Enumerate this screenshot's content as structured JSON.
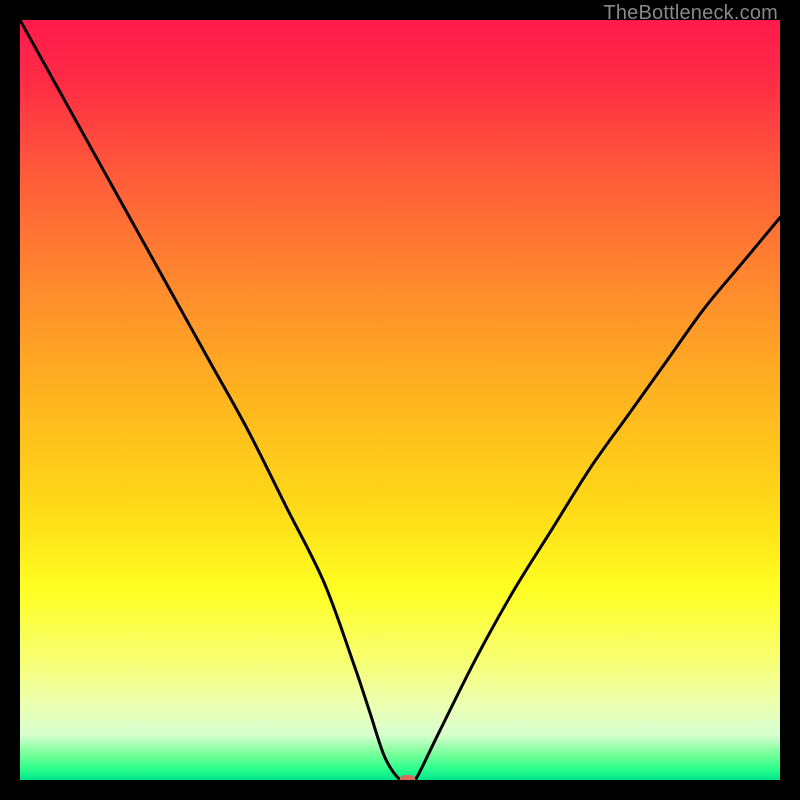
{
  "watermark": "TheBottleneck.com",
  "chart_data": {
    "type": "line",
    "title": "",
    "xlabel": "",
    "ylabel": "",
    "xlim": [
      0,
      100
    ],
    "ylim": [
      0,
      100
    ],
    "background_gradient": {
      "stops": [
        {
          "offset": 0.0,
          "color": "#ff1a4b"
        },
        {
          "offset": 0.08,
          "color": "#ff2b46"
        },
        {
          "offset": 0.2,
          "color": "#ff5a3a"
        },
        {
          "offset": 0.35,
          "color": "#ff8a2e"
        },
        {
          "offset": 0.5,
          "color": "#ffb51f"
        },
        {
          "offset": 0.65,
          "color": "#ffdc18"
        },
        {
          "offset": 0.75,
          "color": "#ffff22"
        },
        {
          "offset": 0.84,
          "color": "#f7ff70"
        },
        {
          "offset": 0.9,
          "color": "#ecffb0"
        },
        {
          "offset": 0.94,
          "color": "#d8ffd0"
        },
        {
          "offset": 0.965,
          "color": "#7aff9a"
        },
        {
          "offset": 0.985,
          "color": "#2eff8e"
        },
        {
          "offset": 1.0,
          "color": "#00e58a"
        }
      ]
    },
    "series": [
      {
        "name": "bottleneck-curve",
        "color": "#000000",
        "x": [
          0,
          5,
          10,
          15,
          20,
          25,
          30,
          35,
          40,
          44,
          46,
          48,
          50,
          51,
          52,
          55,
          60,
          65,
          70,
          75,
          80,
          85,
          90,
          95,
          100
        ],
        "y": [
          100,
          91,
          82,
          73,
          64,
          55,
          46,
          36,
          26,
          15,
          9,
          3,
          0,
          0,
          0,
          6,
          16,
          25,
          33,
          41,
          48,
          55,
          62,
          68,
          74
        ]
      }
    ],
    "marker": {
      "x": 51,
      "y": 0,
      "color": "#d86b5f"
    }
  }
}
